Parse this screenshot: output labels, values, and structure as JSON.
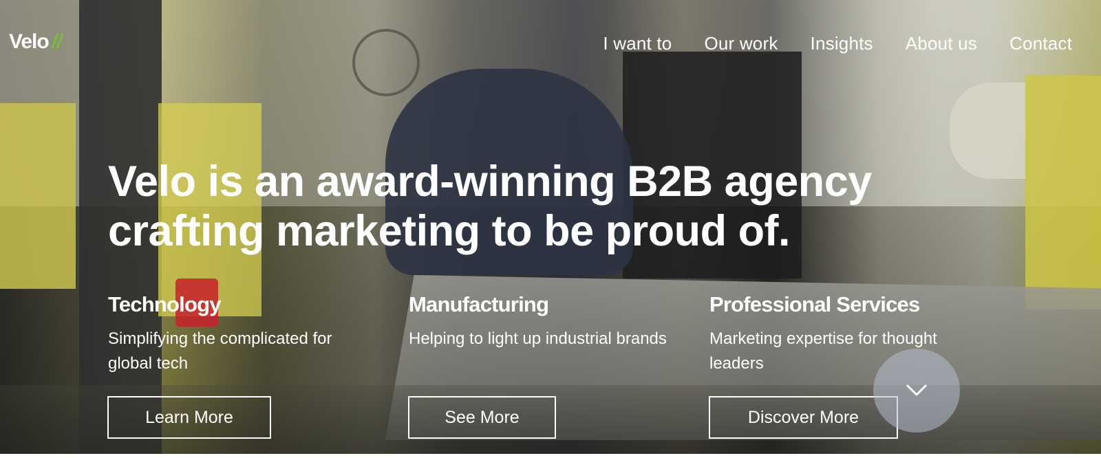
{
  "brand": {
    "name": "Velo",
    "mark": "//",
    "accent_color": "#7ab93d"
  },
  "nav": {
    "items": [
      {
        "label": "I want to"
      },
      {
        "label": "Our work"
      },
      {
        "label": "Insights"
      },
      {
        "label": "About us"
      },
      {
        "label": "Contact"
      }
    ]
  },
  "hero": {
    "headline_line1": "Velo is an award-winning B2B agency",
    "headline_line2": "crafting marketing to be proud of.",
    "scroll_icon": "chevron-down-icon"
  },
  "sectors": [
    {
      "title": "Technology",
      "description": "Simplifying the complicated for global tech",
      "button": "Learn More"
    },
    {
      "title": "Manufacturing",
      "description": "Helping to light up industrial brands",
      "button": "See More"
    },
    {
      "title": "Professional Services",
      "description": "Marketing expertise for thought leaders",
      "button": "Discover More"
    }
  ]
}
